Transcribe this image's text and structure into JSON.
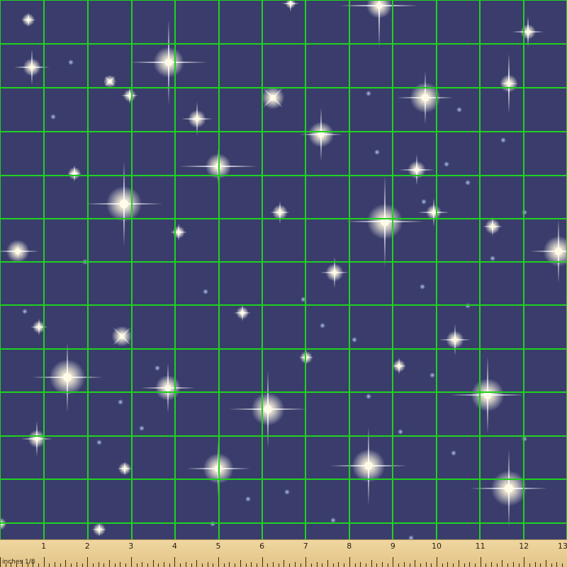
{
  "fabric": {
    "background_color": "#3a3d6b",
    "grid_color": "#1fd21f",
    "star_color": "#fffbe8",
    "pattern": "sparkling stars on navy"
  },
  "ruler": {
    "unit_label": "inches 1/8",
    "numbers": [
      "1",
      "2",
      "3",
      "4",
      "5",
      "6",
      "7",
      "8",
      "9",
      "10",
      "11",
      "12",
      "13"
    ],
    "color": "#efd6a0"
  }
}
